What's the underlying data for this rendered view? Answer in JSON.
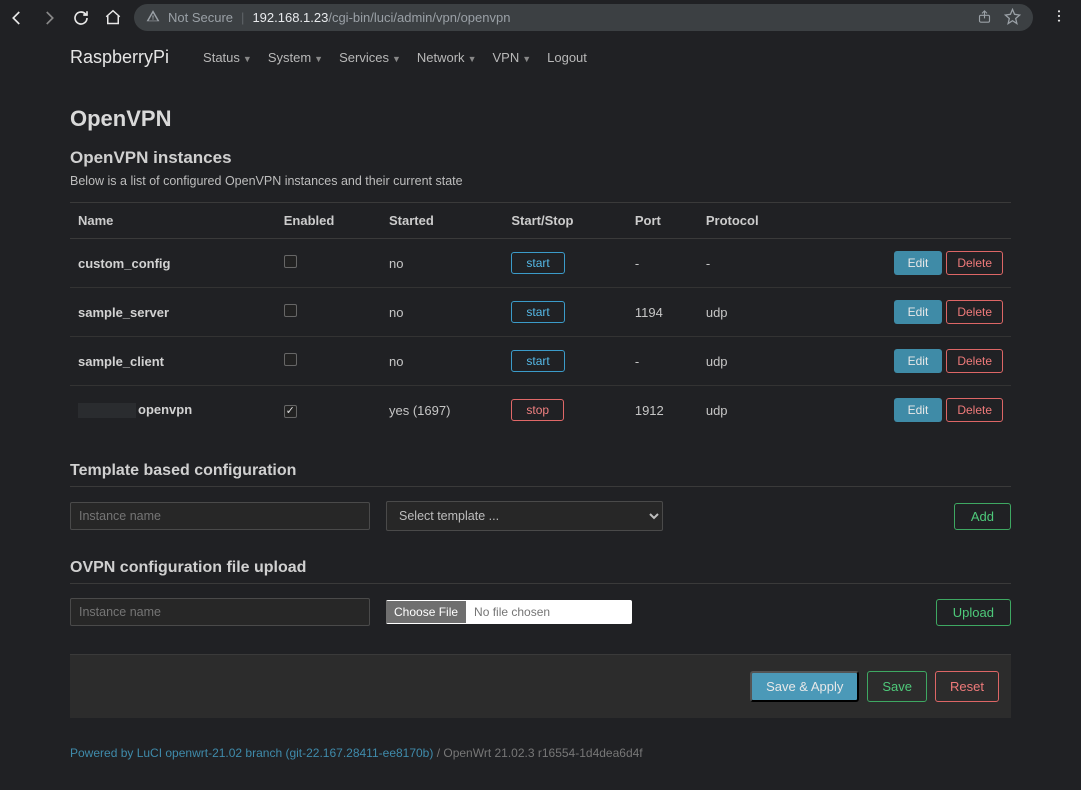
{
  "browser": {
    "not_secure": "Not Secure",
    "url_host": "192.168.1.23",
    "url_path": "/cgi-bin/luci/admin/vpn/openvpn"
  },
  "brand": "RaspberryPi",
  "nav": {
    "items": [
      "Status",
      "System",
      "Services",
      "Network",
      "VPN",
      "Logout"
    ]
  },
  "page_title": "OpenVPN",
  "instances": {
    "title": "OpenVPN instances",
    "desc": "Below is a list of configured OpenVPN instances and their current state",
    "headers": [
      "Name",
      "Enabled",
      "Started",
      "Start/Stop",
      "Port",
      "Protocol",
      ""
    ],
    "rows": [
      {
        "name": "custom_config",
        "enabled": false,
        "started": "no",
        "action": "start",
        "port": "-",
        "proto": "-"
      },
      {
        "name": "sample_server",
        "enabled": false,
        "started": "no",
        "action": "start",
        "port": "1194",
        "proto": "udp"
      },
      {
        "name": "sample_client",
        "enabled": false,
        "started": "no",
        "action": "start",
        "port": "-",
        "proto": "udp"
      },
      {
        "name": "openvpn",
        "obscured_prefix": true,
        "enabled": true,
        "started": "yes (1697)",
        "action": "stop",
        "port": "1912",
        "proto": "udp"
      }
    ],
    "btn_edit": "Edit",
    "btn_delete": "Delete",
    "btn_start": "start",
    "btn_stop": "stop"
  },
  "template_section": {
    "title": "Template based configuration",
    "placeholder": "Instance name",
    "select_placeholder": "Select template ...",
    "add": "Add"
  },
  "ovpn_section": {
    "title": "OVPN configuration file upload",
    "placeholder": "Instance name",
    "choose": "Choose File",
    "nofile": "No file chosen",
    "upload": "Upload"
  },
  "bottom": {
    "save_apply": "Save & Apply",
    "save": "Save",
    "reset": "Reset"
  },
  "footer": {
    "link": "Powered by LuCI openwrt-21.02 branch (git-22.167.28411-ee8170b)",
    "tail": " / OpenWrt 21.02.3 r16554-1d4dea6d4f"
  }
}
